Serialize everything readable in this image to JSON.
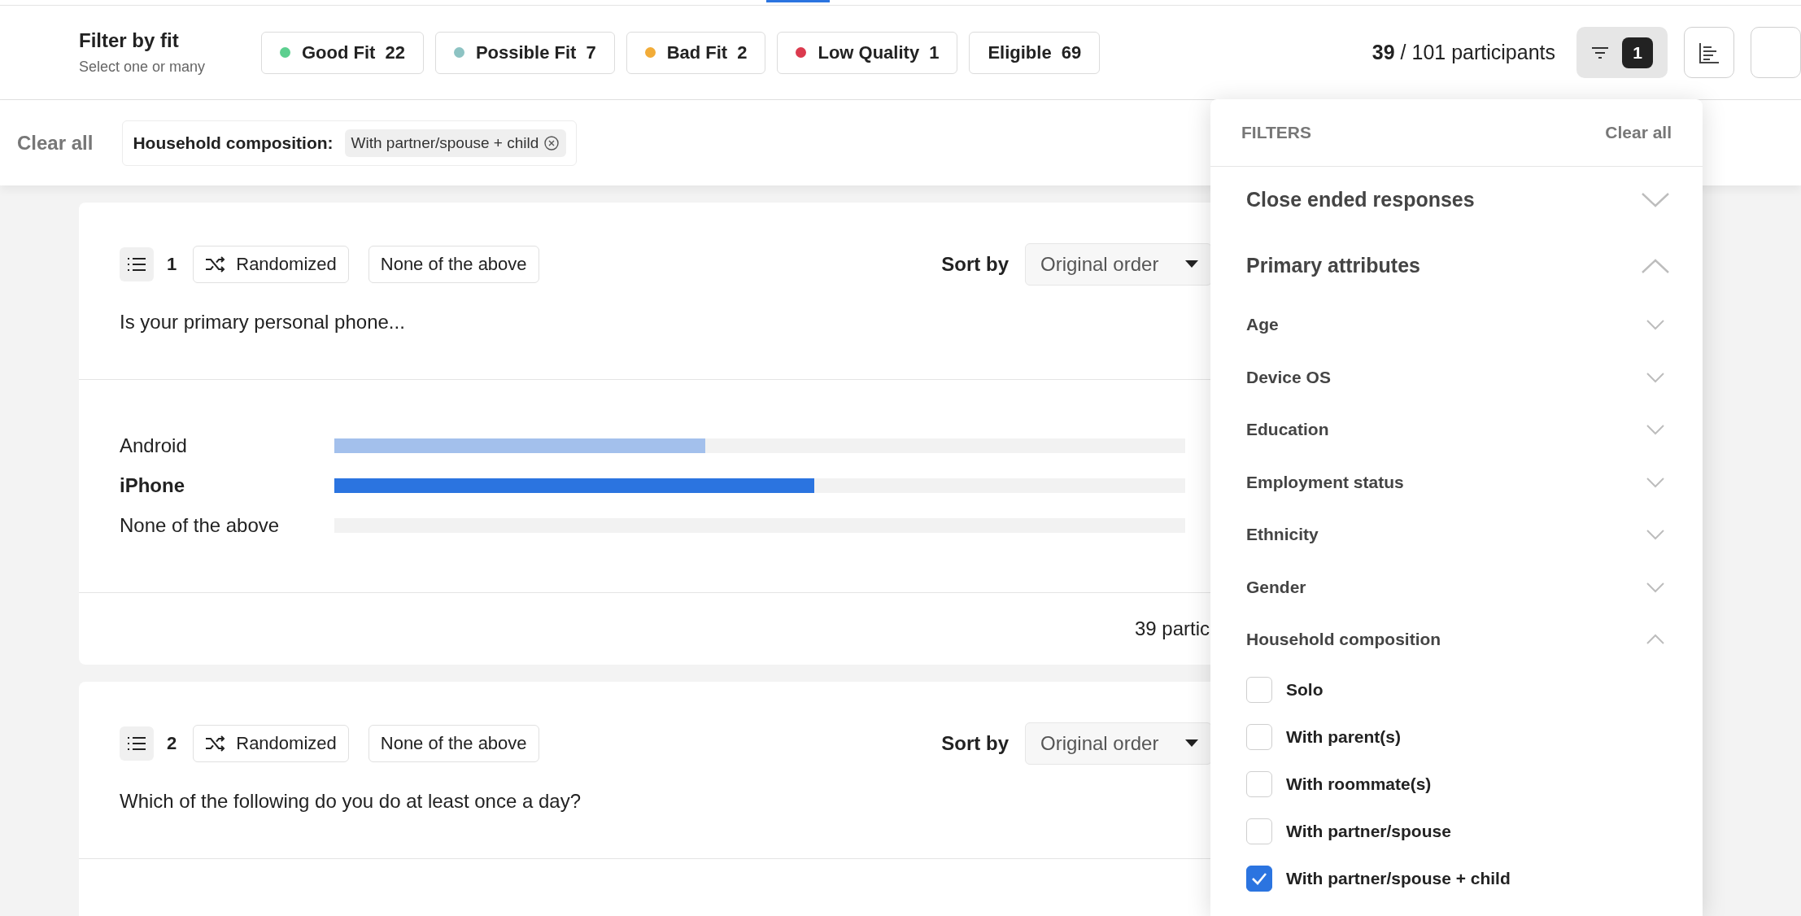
{
  "fit_filter": {
    "title": "Filter by fit",
    "subtitle": "Select one or many",
    "chips": [
      {
        "label": "Good Fit",
        "count": "22",
        "color": "#5ccf8f"
      },
      {
        "label": "Possible Fit",
        "count": "7",
        "color": "#8dc3c3"
      },
      {
        "label": "Bad Fit",
        "count": "2",
        "color": "#f2ac38"
      },
      {
        "label": "Low Quality",
        "count": "1",
        "color": "#db3a4e"
      },
      {
        "label": "Eligible",
        "count": "69"
      }
    ]
  },
  "participants": "**39** / 101 participants",
  "filter_button": {
    "count": "1"
  },
  "active_filters": {
    "clear_label": "Clear all",
    "tags": [
      {
        "attribute": "Household composition:",
        "value": "With partner/spouse + child"
      }
    ]
  },
  "questions": [
    {
      "number": "1",
      "order": "Randomized",
      "option_tag": "None of the above",
      "sort_label": "Sort by",
      "sort_value": "Original order",
      "text": "Is your primary personal phone...",
      "answers": [
        {
          "label": "Android",
          "level": 0.436,
          "highlighted": false
        },
        {
          "label": "iPhone",
          "level": 0.564,
          "highlighted": true
        },
        {
          "label": "None of the above",
          "highlighted": false
        }
      ],
      "footer": "39 partic"
    },
    {
      "number": "2",
      "order": "Randomized",
      "option_tag": "None of the above",
      "sort_label": "Sort by",
      "sort_value": "Original order",
      "text": "Which of the following do you do at least once a day?"
    }
  ],
  "filters_panel": {
    "title": "FILTERS",
    "clear_label": "Clear all",
    "sections": [
      {
        "label": "Close ended responses",
        "expanded": false
      },
      {
        "label": "Primary attributes",
        "expanded": true,
        "children": [
          {
            "label": "Age",
            "expanded": false
          },
          {
            "label": "Device OS",
            "expanded": false
          },
          {
            "label": "Education",
            "expanded": false
          },
          {
            "label": "Employment status",
            "expanded": false
          },
          {
            "label": "Ethnicity",
            "expanded": false
          },
          {
            "label": "Gender",
            "expanded": false
          },
          {
            "label": "Household composition",
            "expanded": true,
            "options": [
              {
                "label": "Solo",
                "checked": false
              },
              {
                "label": "With parent(s)",
                "checked": false
              },
              {
                "label": "With roommate(s)",
                "checked": false
              },
              {
                "label": "With partner/spouse",
                "checked": false
              },
              {
                "label": "With partner/spouse + child",
                "checked": true
              }
            ]
          }
        ]
      }
    ]
  }
}
